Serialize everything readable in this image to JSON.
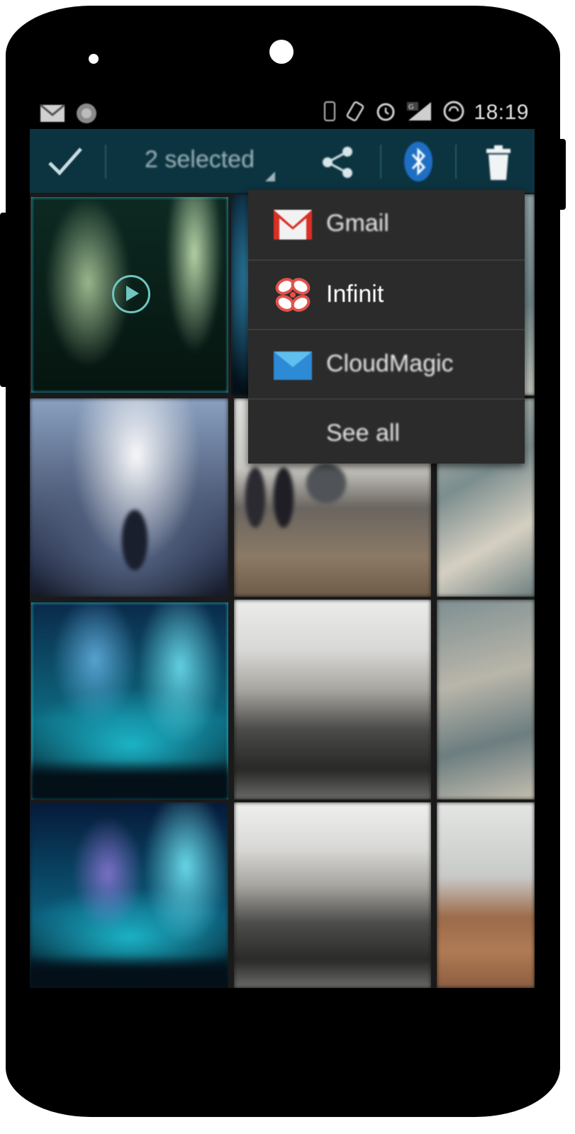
{
  "status_bar": {
    "time": "18:19",
    "left_icons": [
      "mail-icon",
      "app-icon"
    ],
    "right_icons": [
      "vibrate-icon",
      "rotate-icon",
      "alarm-icon",
      "signal-icon",
      "sync-icon"
    ]
  },
  "action_bar": {
    "done_icon": "checkmark-icon",
    "selection_label": "2 selected",
    "share_icon": "share-icon",
    "bluetooth_icon": "bluetooth-icon",
    "delete_icon": "trash-icon",
    "accent_color": "#1aa0b3",
    "background_color": "#0c3340"
  },
  "share_menu": {
    "items": [
      {
        "label": "Gmail",
        "icon": "gmail-icon"
      },
      {
        "label": "Infinit",
        "icon": "infinit-icon"
      },
      {
        "label": "CloudMagic",
        "icon": "cloudmagic-icon"
      },
      {
        "label": "See all",
        "icon": ""
      }
    ]
  },
  "gallery": {
    "selection_color": "#1fb5c4",
    "tiles": [
      {
        "kind": "concert-video",
        "selected": true
      },
      {
        "kind": "concert-blue",
        "selected": false
      },
      {
        "kind": "sky",
        "selected": false
      },
      {
        "kind": "concert-white",
        "selected": false
      },
      {
        "kind": "office",
        "selected": false
      },
      {
        "kind": "sky",
        "selected": false
      },
      {
        "kind": "concert-cyan",
        "selected": true
      },
      {
        "kind": "street",
        "selected": false
      },
      {
        "kind": "sky",
        "selected": false
      },
      {
        "kind": "concert-cyan",
        "selected": false
      },
      {
        "kind": "street",
        "selected": false
      },
      {
        "kind": "snow-building",
        "selected": false
      }
    ]
  }
}
